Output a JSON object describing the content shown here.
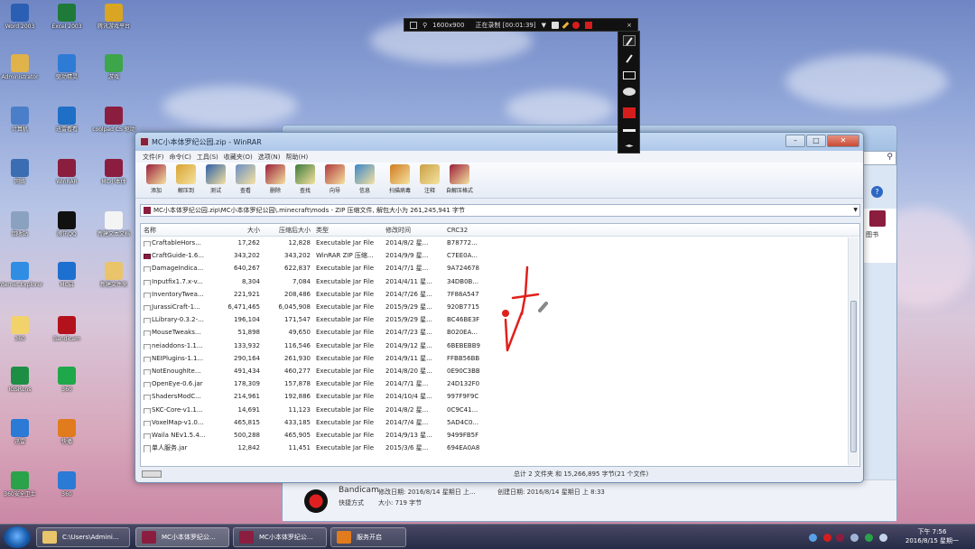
{
  "desktop": {
    "icons": [
      {
        "label": "Word 2003",
        "color": "#2b5fb3"
      },
      {
        "label": "Excel 2003",
        "color": "#1f7a3a"
      },
      {
        "label": "腾讯游戏平台",
        "color": "#d9a522"
      },
      {
        "label": "Administrator",
        "color": "#e0b24a"
      },
      {
        "label": "驱动精灵",
        "color": "#2e7bd6"
      },
      {
        "label": "游戏",
        "color": "#3da54a"
      },
      {
        "label": "计算机",
        "color": "#4a7ec9"
      },
      {
        "label": "迅雷看看",
        "color": "#1f6fc7"
      },
      {
        "label": "coolpad CS 驱动",
        "color": "#8b1e3f"
      },
      {
        "label": "网络",
        "color": "#3b6db3"
      },
      {
        "label": "WinRAR",
        "color": "#8b1e3f"
      },
      {
        "label": "MC小本体",
        "color": "#8b1e3f"
      },
      {
        "label": "回收站",
        "color": "#8aa2c0"
      },
      {
        "label": "腾讯QQ",
        "color": "#111111"
      },
      {
        "label": "新建文本文档",
        "color": "#f4f4f4"
      },
      {
        "label": "Internet Explorer",
        "color": "#2f8de4"
      },
      {
        "label": "MC启",
        "color": "#1d6fd0"
      },
      {
        "label": "新建文件夹",
        "color": "#e9c46a"
      },
      {
        "label": "360",
        "color": "#f2d36b"
      },
      {
        "label": "Bandicam",
        "color": "#b3121c"
      },
      {
        "label": "IGSRuns",
        "color": "#1d8f45"
      },
      {
        "label": "360",
        "color": "#1fa84a"
      },
      {
        "label": "迅雷",
        "color": "#2a7ad6"
      },
      {
        "label": "快播",
        "color": "#e07b1e"
      },
      {
        "label": "360安全卫士",
        "color": "#2aa24a"
      },
      {
        "label": "360",
        "color": "#2a7ad6"
      }
    ]
  },
  "recorder": {
    "size": "1600x900",
    "status": "正在录制 [00:01:39]"
  },
  "back_window": {
    "app_name": "Bandicam",
    "modified": "修改日期: 2016/8/14 星期日 上...",
    "created": "创建日期: 2016/8/14 星期日 上 8:33",
    "kind": "快捷方式",
    "size": "大小: 719 字节",
    "side_label": "图书"
  },
  "winrar": {
    "title": "MC小本体罗纪公园.zip - WinRAR",
    "menu": [
      "文件(F)",
      "命令(C)",
      "工具(S)",
      "收藏夹(O)",
      "选项(N)",
      "帮助(H)"
    ],
    "toolbar": [
      {
        "label": "添加",
        "color": "#9b1f3a"
      },
      {
        "label": "解压到",
        "color": "#d8a330"
      },
      {
        "label": "测试",
        "color": "#2d5fa8"
      },
      {
        "label": "查看",
        "color": "#6b8fc4"
      },
      {
        "label": "删除",
        "color": "#9b1f3a"
      },
      {
        "label": "查找",
        "color": "#3d7a3a"
      },
      {
        "label": "向导",
        "color": "#b0393b"
      },
      {
        "label": "信息",
        "color": "#3b86c8"
      },
      {
        "label": "扫描病毒",
        "color": "#d07b20"
      },
      {
        "label": "注释",
        "color": "#c9a144"
      },
      {
        "label": "自解压格式",
        "color": "#9b1f3a"
      }
    ],
    "path": "MC小本体罗纪公园.zip\\MC小本体罗纪公园\\.minecraft\\mods - ZIP 压缩文件, 解包大小为 261,245,941 字节",
    "columns": {
      "name": "名称",
      "size": "大小",
      "packed": "压缩后大小",
      "type": "类型",
      "modified": "修改时间",
      "crc": "CRC32"
    },
    "files": [
      {
        "name": "CraftableHors...",
        "size": "17,262",
        "packed": "12,828",
        "type": "Executable Jar File",
        "modified": "2014/8/2 星...",
        "crc": "B78772..."
      },
      {
        "name": "CraftGuide-1.6...",
        "size": "343,202",
        "packed": "343,202",
        "type": "WinRAR ZIP 压缩...",
        "modified": "2014/9/9 星...",
        "crc": "C7EE0A...",
        "zip": true
      },
      {
        "name": "DamageIndica...",
        "size": "640,267",
        "packed": "622,837",
        "type": "Executable Jar File",
        "modified": "2014/7/1 星...",
        "crc": "9A724678"
      },
      {
        "name": "Inputfix1.7.x-v...",
        "size": "8,304",
        "packed": "7,084",
        "type": "Executable Jar File",
        "modified": "2014/4/11 星...",
        "crc": "34DB0B..."
      },
      {
        "name": "InventoryTwea...",
        "size": "221,921",
        "packed": "208,486",
        "type": "Executable Jar File",
        "modified": "2014/7/26 星...",
        "crc": "7F88A547"
      },
      {
        "name": "JurassiCraft-1...",
        "size": "6,471,465",
        "packed": "6,045,908",
        "type": "Executable Jar File",
        "modified": "2015/9/29 星...",
        "crc": "920B7715"
      },
      {
        "name": "LLibrary-0.3.2-...",
        "size": "196,104",
        "packed": "171,547",
        "type": "Executable Jar File",
        "modified": "2015/9/29 星...",
        "crc": "BC46BE3F"
      },
      {
        "name": "MouseTweaks...",
        "size": "51,898",
        "packed": "49,650",
        "type": "Executable Jar File",
        "modified": "2014/7/23 星...",
        "crc": "B020EA..."
      },
      {
        "name": "neiaddons-1.1...",
        "size": "133,932",
        "packed": "116,546",
        "type": "Executable Jar File",
        "modified": "2014/9/12 星...",
        "crc": "6BEBEBB9"
      },
      {
        "name": "NEIPlugins-1.1...",
        "size": "290,164",
        "packed": "261,930",
        "type": "Executable Jar File",
        "modified": "2014/9/11 星...",
        "crc": "FFBB56BB"
      },
      {
        "name": "NotEnoughIte...",
        "size": "491,434",
        "packed": "460,277",
        "type": "Executable Jar File",
        "modified": "2014/8/20 星...",
        "crc": "0E90C3BB"
      },
      {
        "name": "OpenEye-0.6.jar",
        "size": "178,309",
        "packed": "157,878",
        "type": "Executable Jar File",
        "modified": "2014/7/1 星...",
        "crc": "24D132F0"
      },
      {
        "name": "ShadersModC...",
        "size": "214,961",
        "packed": "192,886",
        "type": "Executable Jar File",
        "modified": "2014/10/4 星...",
        "crc": "997F9F9C"
      },
      {
        "name": "SKC-Core-v1.1...",
        "size": "14,691",
        "packed": "11,123",
        "type": "Executable Jar File",
        "modified": "2014/8/2 星...",
        "crc": "0C9C41..."
      },
      {
        "name": "VoxelMap-v1.0...",
        "size": "465,815",
        "packed": "433,185",
        "type": "Executable Jar File",
        "modified": "2014/7/4 星...",
        "crc": "5AD4C0..."
      },
      {
        "name": "Waila NEv1.5.4...",
        "size": "500,288",
        "packed": "465,905",
        "type": "Executable Jar File",
        "modified": "2014/9/13 星...",
        "crc": "9499FB5F"
      },
      {
        "name": "单人服务.jar",
        "size": "12,842",
        "packed": "11,451",
        "type": "Executable Jar File",
        "modified": "2015/3/6 星...",
        "crc": "694EA0A8"
      }
    ],
    "status": "总计 2 文件夹 和 15,266,895 字节(21 个文件)"
  },
  "taskbar": {
    "tasks": [
      {
        "label": "C:\\Users\\Admini...",
        "color": "#e9c46a"
      },
      {
        "label": "MC小本体罗纪公...",
        "color": "#8b1e3f"
      },
      {
        "label": "MC小本体罗纪公...",
        "color": "#8b1e3f"
      },
      {
        "label": "服务开启",
        "color": "#e07b1e"
      }
    ],
    "time": "下午 7:56",
    "date": "2016/8/15 星期一"
  },
  "colors": {
    "record_red": "#d61d1d",
    "annotation_red": "#e0201c"
  }
}
